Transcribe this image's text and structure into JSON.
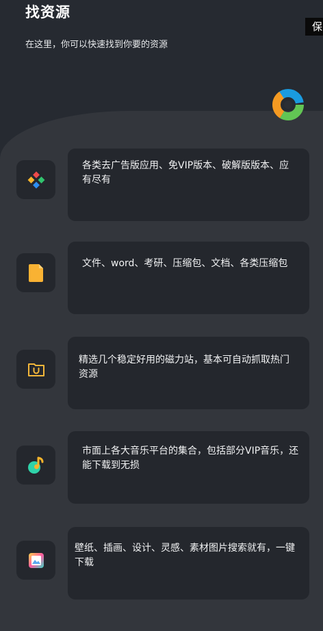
{
  "header": {
    "title": "找资源",
    "subtitle": "在这里，你可以快速找到你要的资源"
  },
  "side_tab": {
    "label": "保"
  },
  "logo": {
    "icon": "circular-arrows-logo-icon",
    "colors": [
      "#62c554",
      "#f59a22",
      "#1a9be0"
    ]
  },
  "items": [
    {
      "icon": "app-diamond-icon",
      "text": "各类去广告版应用、免VIP版本、破解版版本、应有尽有"
    },
    {
      "icon": "document-icon",
      "text": "文件、word、考研、压缩包、文档、各类压缩包"
    },
    {
      "icon": "magnet-folder-icon",
      "text": "精选几个稳定好用的磁力站，基本可自动抓取热门资源"
    },
    {
      "icon": "music-note-icon",
      "text": "市面上各大音乐平台的集合，包括部分VIP音乐，还能下载到无损"
    },
    {
      "icon": "image-gallery-icon",
      "text": "壁纸、插画、设计、灵感、素材图片搜索就有，一键下载"
    }
  ]
}
